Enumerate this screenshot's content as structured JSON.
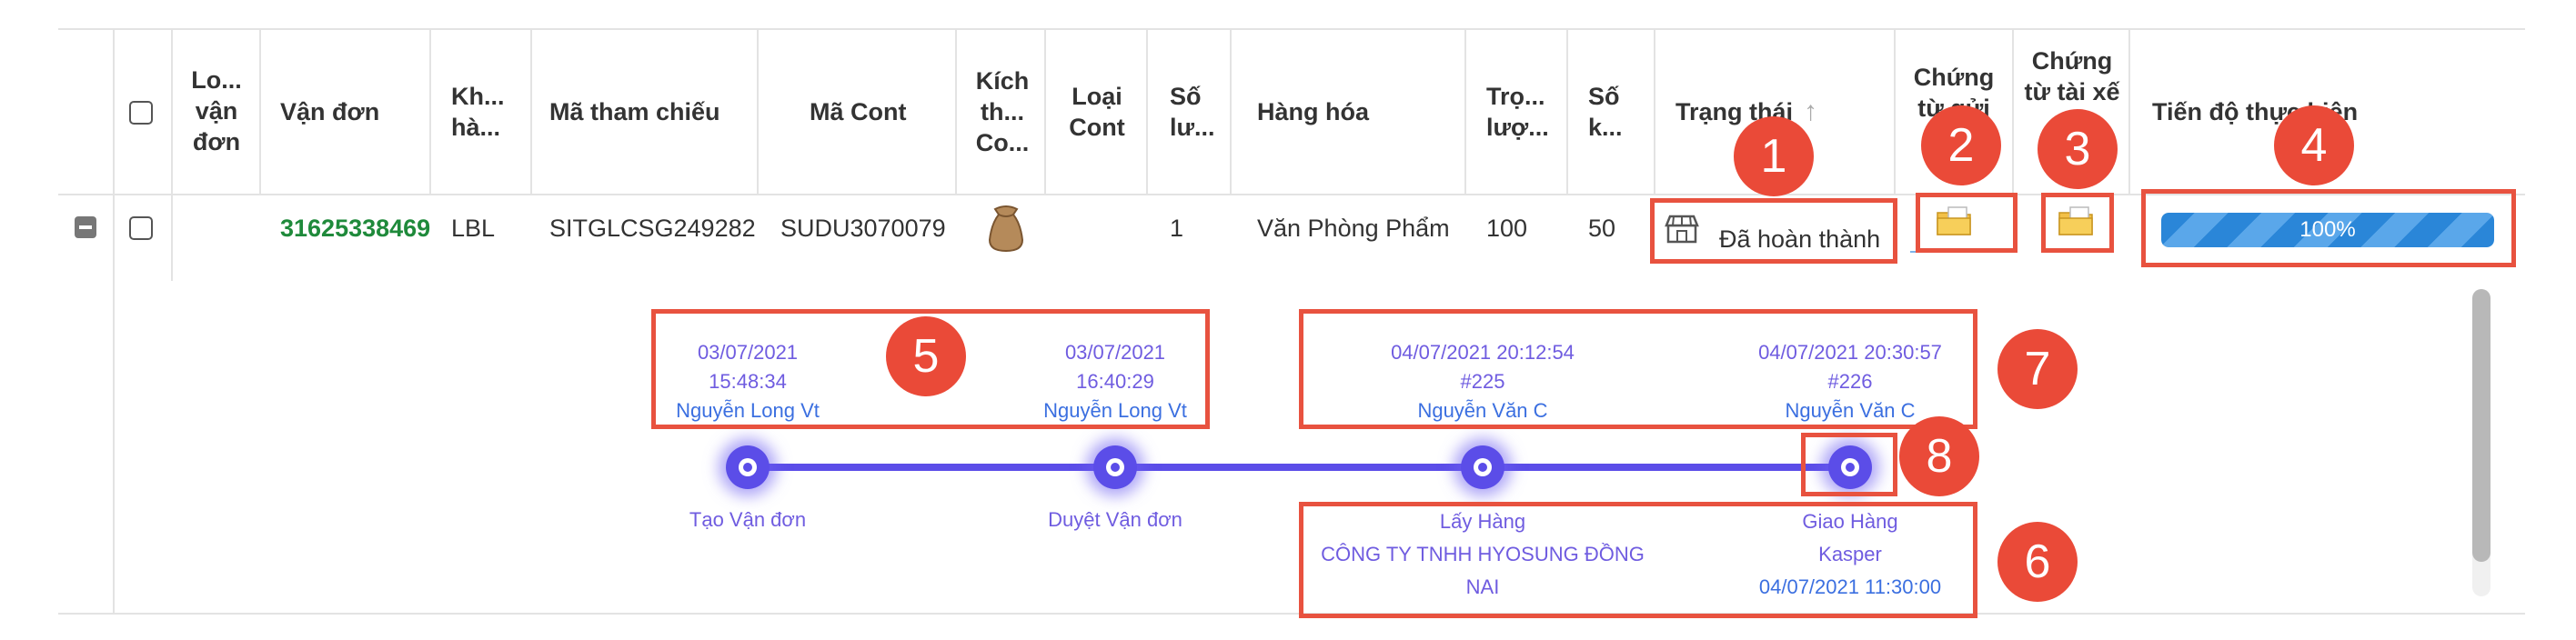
{
  "table": {
    "headers": {
      "loai_van_don": "Lo... vận đơn",
      "van_don": "Vận đơn",
      "kho_hang": "Kh... hà...",
      "ma_tham_chieu": "Mã tham chiếu",
      "ma_cont": "Mã Cont",
      "kich_thuoc": "Kích th... Co...",
      "loai_cont": "Loại Cont",
      "so_luong": "Số lư...",
      "hang_hoa": "Hàng hóa",
      "trong_luong": "Trọ... lượ...",
      "so_khoi": "Số k...",
      "trang_thai": "Trạng thái",
      "chung_tu_gui": "Chứng từ gửi",
      "chung_tu_tai_xe": "Chứng từ tài xế",
      "tien_do": "Tiến độ thực hiện"
    },
    "row": {
      "van_don": "31625338469",
      "kho_hang": "LBL",
      "ma_tham_chieu": "SITGLCSG249282",
      "ma_cont": "SUDU3070079",
      "so_luong": "1",
      "hang_hoa": "Văn Phòng Phẩm",
      "trong_luong": "100",
      "so_khoi": "50",
      "trang_thai": "Đã hoàn thành",
      "progress_percent": 100,
      "progress_label": "100%"
    }
  },
  "timeline": {
    "steps": [
      {
        "date": "03/07/2021",
        "time": "15:48:34",
        "user": "Nguyễn Long Vt",
        "label": "Tạo Vận đơn"
      },
      {
        "date": "03/07/2021",
        "time": "16:40:29",
        "user": "Nguyễn Long Vt",
        "label": "Duyệt Vận đơn"
      },
      {
        "date": "04/07/2021 20:12:54",
        "time": "#225",
        "user": "Nguyễn Văn C",
        "label": "Lấy Hàng",
        "detail1": "CÔNG TY TNHH HYOSUNG ĐỒNG",
        "detail2": "NAI"
      },
      {
        "date": "04/07/2021 20:30:57",
        "time": "#226",
        "user": "Nguyễn Văn C",
        "label": "Giao Hàng",
        "detail1": "Kasper",
        "detail2": "04/07/2021 11:30:00"
      }
    ]
  },
  "annotations": [
    "1",
    "2",
    "3",
    "4",
    "5",
    "6",
    "7",
    "8"
  ],
  "colors": {
    "link_green": "#1f8a3b",
    "timeline_purple": "#5b4de8",
    "progress_blue": "#2a86d8",
    "annotation_red": "#e8523f"
  },
  "icons": {
    "expand": "minus-square-icon",
    "kich_thuoc": "sack-icon",
    "trang_thai": "store-icon",
    "chung_tu": "folder-icon",
    "sort": "sort-up-arrow-icon"
  }
}
